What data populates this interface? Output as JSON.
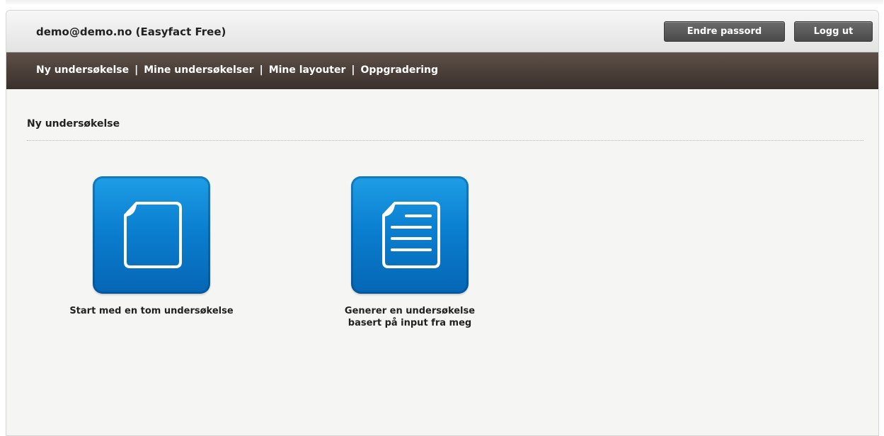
{
  "header": {
    "account_label": "demo@demo.no (Easyfact Free)",
    "change_password_label": "Endre passord",
    "logout_label": "Logg ut"
  },
  "nav": {
    "items": [
      {
        "label": "Ny undersøkelse"
      },
      {
        "label": "Mine undersøkelser"
      },
      {
        "label": "Mine layouter"
      },
      {
        "label": "Oppgradering"
      }
    ],
    "separator": "|"
  },
  "main": {
    "title": "Ny undersøkelse",
    "options": [
      {
        "icon": "blank-document-icon",
        "label_line1": "Start med en tom undersøkelse",
        "label_line2": ""
      },
      {
        "icon": "text-document-icon",
        "label_line1": "Generer en undersøkelse",
        "label_line2": "basert på input fra meg"
      }
    ]
  },
  "colors": {
    "nav_bg": "#4a3f39",
    "tile_blue": "#0b7fd0",
    "button_dark": "#555555"
  }
}
